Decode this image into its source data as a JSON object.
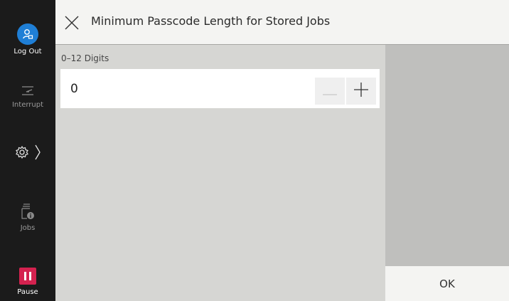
{
  "sidebar": {
    "logout_label": "Log Out",
    "interrupt_label": "Interrupt",
    "jobs_label": "Jobs",
    "pause_label": "Pause"
  },
  "header": {
    "title": "Minimum Passcode Length for Stored Jobs"
  },
  "setting": {
    "range_label": "0–12 Digits",
    "value": "0"
  },
  "footer": {
    "ok_label": "OK"
  },
  "colors": {
    "accent_blue": "#1f7fd6",
    "pause_red": "#d4224f"
  },
  "icons": [
    "user-icon",
    "interrupt-icon",
    "gear-icon",
    "chevron-right-icon",
    "jobs-icon",
    "pause-icon",
    "close-icon",
    "minus-icon",
    "plus-icon"
  ]
}
